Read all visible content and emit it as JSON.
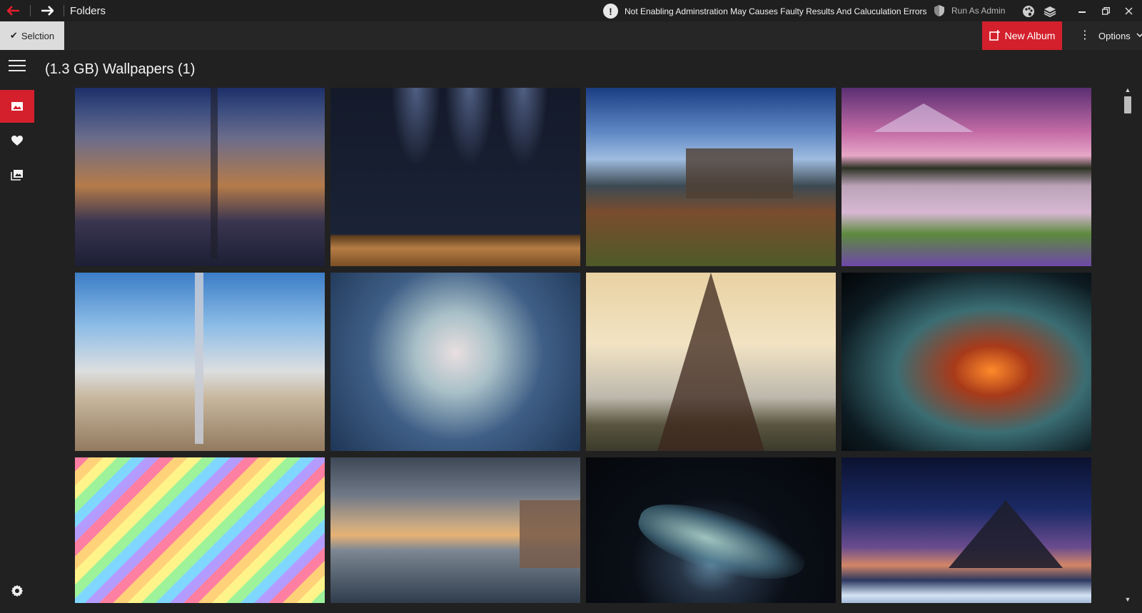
{
  "window": {
    "title": "Folders",
    "warning": "Not Enabling Adminstration May Causes Faulty Results And Caluculation Errors",
    "run_as_admin": "Run As Admin"
  },
  "toolbar": {
    "selection_label": "Selction",
    "new_album_label": "New Album",
    "options_label": "Options"
  },
  "page": {
    "title": "(1.3 GB) Wallpapers (1)"
  },
  "colors": {
    "accent": "#d3202c",
    "background": "#212121",
    "titlebar": "#1f1f1f"
  },
  "icons": {
    "back": "arrow-left-icon",
    "forward": "arrow-right-icon",
    "warning": "exclamation-circle-icon",
    "admin": "shield-icon",
    "theme": "palette-icon",
    "layers": "layers-icon",
    "selection": "check-mark-icon",
    "new_album": "new-album-icon",
    "options": "more-vertical-icon",
    "menu": "hamburger-icon",
    "pictures": "image-icon",
    "favorites": "heart-icon",
    "albums": "albums-icon",
    "settings": "gear-icon"
  }
}
